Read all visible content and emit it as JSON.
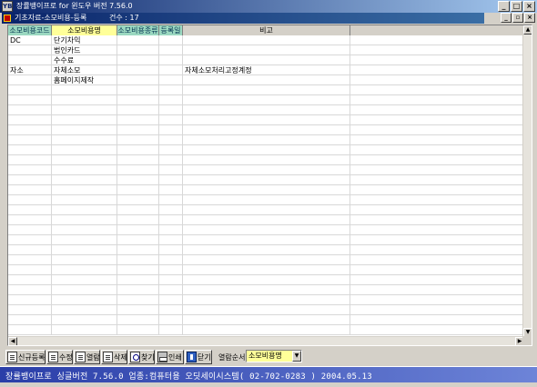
{
  "window": {
    "title": "장률뱅이프로 for 윈도우 버전 7.56.0",
    "app_icon": "YB",
    "buttons": {
      "minimize": "_",
      "maximize": "□",
      "close": "×"
    }
  },
  "child_window": {
    "title": "기초자료-소모비용-등록",
    "count_label": "건수 : 17",
    "buttons": {
      "minimize": "_",
      "restore": "▫",
      "close": "×"
    }
  },
  "grid": {
    "columns": [
      {
        "label": "소모비용코드",
        "color": "green"
      },
      {
        "label": "소모비용명",
        "color": "yellow"
      },
      {
        "label": "소모비용종류",
        "color": "green"
      },
      {
        "label": "등록일",
        "color": "green"
      },
      {
        "label": "비고",
        "color": "grey"
      },
      {
        "label": "",
        "color": "grey"
      }
    ],
    "rows": [
      [
        "DC",
        "단기차익",
        "",
        "",
        "",
        ""
      ],
      [
        "",
        "법인카드",
        "",
        "",
        "",
        ""
      ],
      [
        "",
        "수수료",
        "",
        "",
        "",
        ""
      ],
      [
        "자소",
        "자체소모",
        "",
        "",
        "자체소모처리고정계정",
        ""
      ],
      [
        "",
        "홈페이지제작",
        "",
        "",
        "",
        ""
      ]
    ],
    "empty_rows": 25
  },
  "toolbar": {
    "buttons": [
      {
        "label": "신규등록",
        "icon": "new-doc-icon"
      },
      {
        "label": "수정",
        "icon": "edit-doc-icon"
      },
      {
        "label": "열람",
        "icon": "view-doc-icon"
      },
      {
        "label": "삭제",
        "icon": "delete-doc-icon"
      },
      {
        "label": "찾기",
        "icon": "find-icon"
      },
      {
        "label": "인쇄",
        "icon": "printer-icon"
      },
      {
        "label": "닫기",
        "icon": "close-door-icon"
      }
    ],
    "sort_label": "열람순서",
    "sort_value": "소모비용명"
  },
  "status_bar": {
    "text": "장률뱅이프로 싱글버전 7.56.0   업종:컴퓨터용   오딧세이시스템( 02-702-0283 )   2004.05.13"
  },
  "colors": {
    "title_gradient_start": "#0a246a",
    "header_green": "#9bd8c0",
    "header_yellow": "#ffff99",
    "statusbar": "#2a3ea8"
  }
}
